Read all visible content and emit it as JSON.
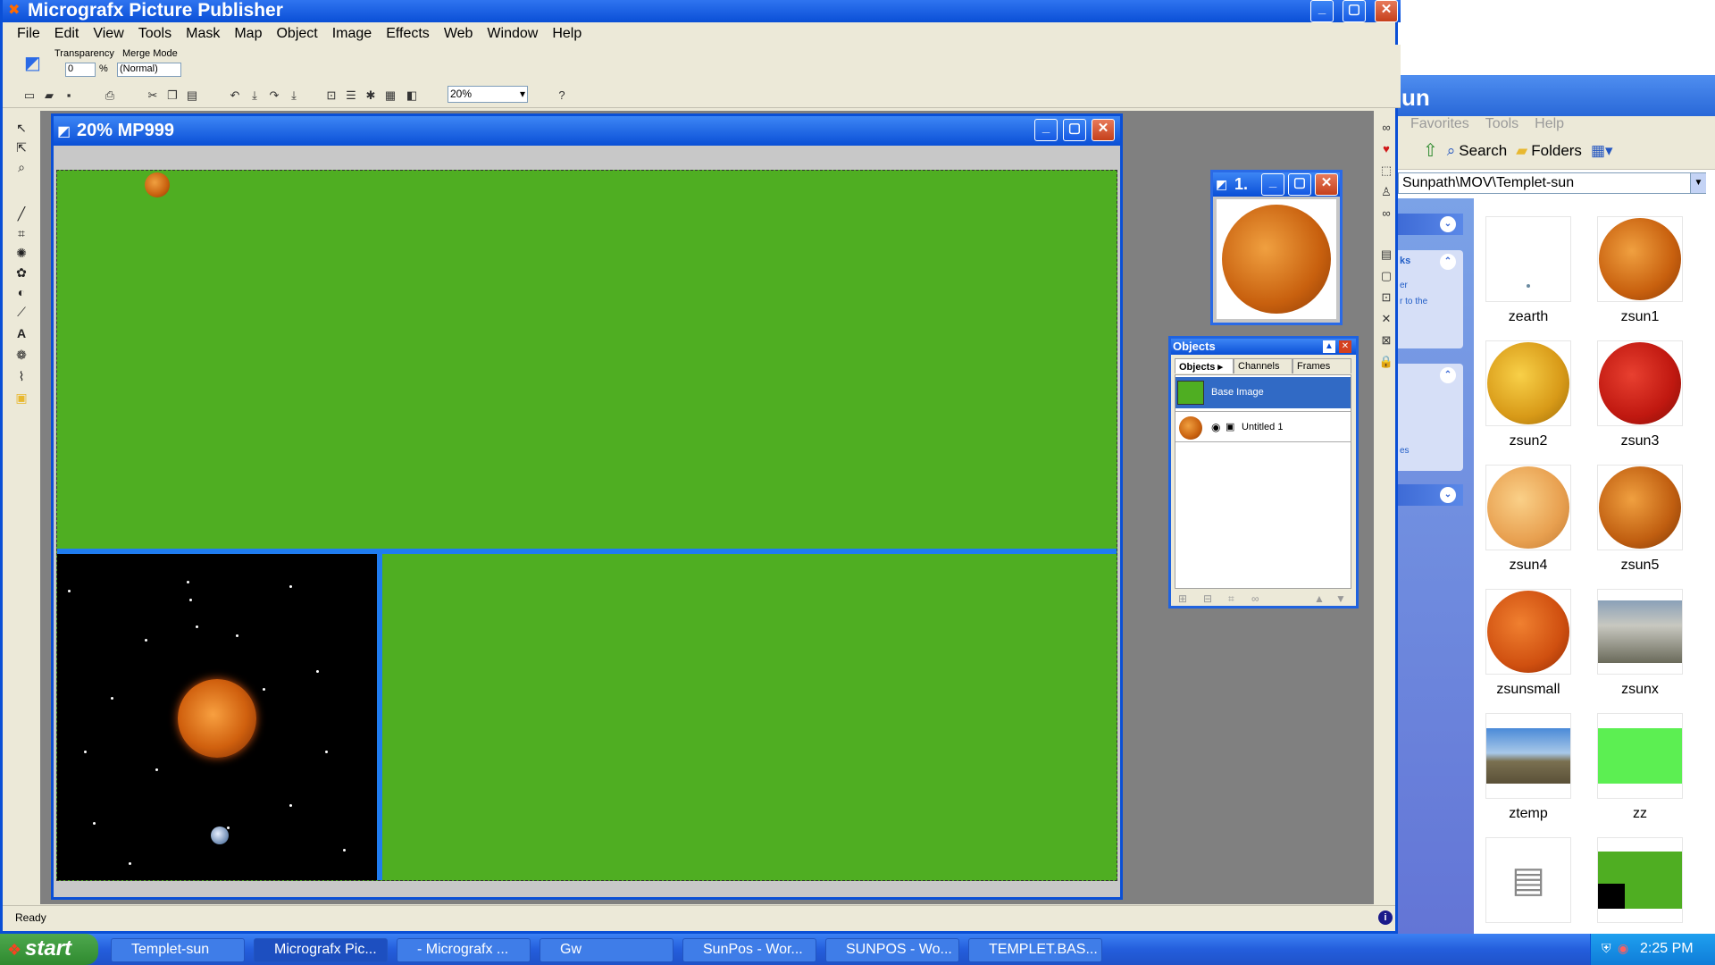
{
  "app": {
    "title": "Micrografx Picture Publisher",
    "menu": [
      "File",
      "Edit",
      "View",
      "Tools",
      "Mask",
      "Map",
      "Object",
      "Image",
      "Effects",
      "Web",
      "Window",
      "Help"
    ],
    "options": {
      "transparency_label": "Transparency",
      "transparency_value": "0",
      "transparency_unit": "%",
      "merge_mode_label": "Merge Mode",
      "merge_mode_value": "(Normal)"
    },
    "zoom_value": "20%",
    "status_text": "Ready"
  },
  "document": {
    "title": "20% MP999"
  },
  "preview_window": {
    "title": "1."
  },
  "objects_panel": {
    "title": "Objects",
    "tabs": [
      "Objects ▸",
      "Channels",
      "Frames"
    ],
    "items": [
      "Base Image",
      "Untitled 1"
    ]
  },
  "explorer": {
    "title_fragment": "un",
    "menu": [
      "Favorites",
      "Tools",
      "Help"
    ],
    "toolbar": {
      "search_label": "Search",
      "folders_label": "Folders"
    },
    "address": "Sunpath\\MOV\\Templet-sun",
    "side_fragments": [
      "ks",
      "er",
      "r to the",
      "es"
    ],
    "files": [
      "zearth",
      "zsun1",
      "zsun2",
      "zsun3",
      "zsun4",
      "zsun5",
      "zsunsmall",
      "zsunx",
      "ztemp",
      "zz",
      "",
      ""
    ]
  },
  "taskbar": {
    "start_label": "start",
    "tasks": [
      "Templet-sun",
      "Micrografx Pic...",
      "- Micrografx ...",
      "Gw",
      "SunPos - Wor...",
      "SUNPOS - Wo...",
      "TEMPLET.BAS..."
    ],
    "clock": "2:25 PM"
  },
  "colors": {
    "canvas_green": "#4fae22",
    "title_blue": "#0a4fd6",
    "divider_blue": "#1f7cf0"
  }
}
